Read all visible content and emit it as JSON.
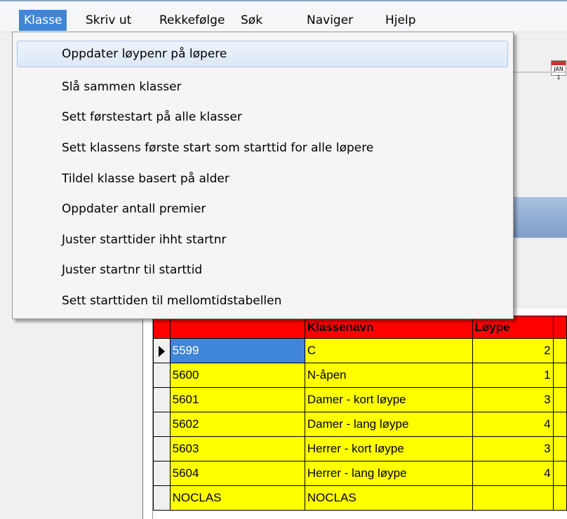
{
  "menubar": {
    "items": [
      "Klasse",
      "Skriv ut",
      "Rekkefølge",
      "Søk",
      "Naviger",
      "Hjelp"
    ]
  },
  "dropdown": {
    "items": [
      "Oppdater løypenr på løpere",
      "Slå sammen klasser",
      "Sett førstestart på alle klasser",
      "Sett klassens første start som starttid for alle løpere",
      "Tildel klasse basert på alder",
      "Oppdater antall premier",
      "Juster starttider  ihht startnr",
      "Juster startnr til starttid",
      "Sett starttiden til mellomtidstabellen"
    ]
  },
  "grid": {
    "headers": [
      "",
      "Klassenavn",
      "Løype",
      ""
    ],
    "rows": [
      {
        "id": "5599",
        "name": "C",
        "course": "2"
      },
      {
        "id": "5600",
        "name": "N-åpen",
        "course": "1"
      },
      {
        "id": "5601",
        "name": "Damer - kort løype",
        "course": "3"
      },
      {
        "id": "5602",
        "name": "Damer - lang løype",
        "course": "4"
      },
      {
        "id": "5603",
        "name": "Herrer - kort løype",
        "course": "3"
      },
      {
        "id": "5604",
        "name": "Herrer - lang løype",
        "course": "4"
      },
      {
        "id": "NOCLAS",
        "name": "NOCLAS",
        "course": ""
      }
    ]
  },
  "toolbar": {
    "calendar_icon": "calendar-icon",
    "calendar_text": "JAN 1"
  },
  "colors": {
    "menu_active": "#3f86d8",
    "grid_header": "#ff0000",
    "grid_row": "#ffff00",
    "selection": "#3f86d8"
  }
}
